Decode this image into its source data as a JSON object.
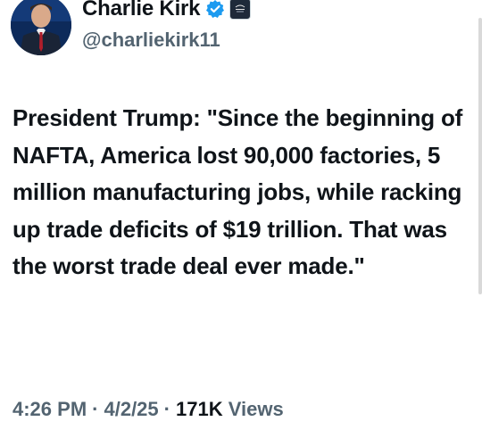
{
  "author": {
    "display_name": "Charlie Kirk",
    "handle": "@charliekirk11",
    "verified_icon": "verified-badge-icon",
    "affiliation_icon": "affiliation-badge-icon"
  },
  "tweet": {
    "text": "President Trump: \"Since the beginning of NAFTA, America lost 90,000 factories, 5 million manufacturing jobs, while racking up trade deficits of $19 trillion. That was the worst trade deal ever made.\""
  },
  "meta": {
    "time": "4:26 PM",
    "separator": "·",
    "date": "4/2/25",
    "views_count": "171K",
    "views_label": "Views"
  },
  "colors": {
    "text": "#0f1419",
    "secondary": "#536471",
    "verified": "#1d9bf0"
  }
}
